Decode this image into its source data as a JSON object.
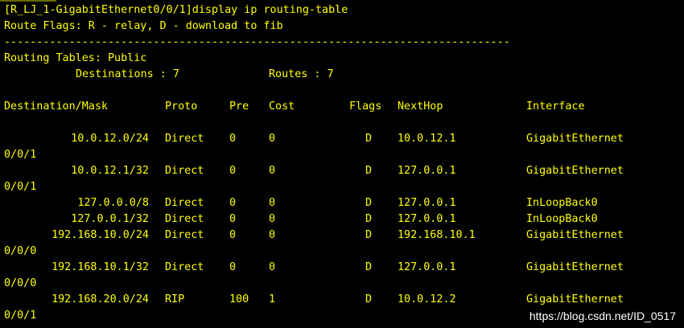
{
  "terminal": {
    "command": "[R_LJ_1-GigabitEthernet0/0/1]display ip routing-table",
    "flags_line": "Route Flags: R - relay, D - download to fib",
    "separator": "------------------------------------------------------------------------------",
    "tables_line": "Routing Tables: Public",
    "destinations_label": "Destinations : 7",
    "routes_label": "Routes : 7",
    "headers": {
      "dest": "Destination/Mask",
      "proto": "Proto",
      "pre": "Pre",
      "cost": "Cost",
      "flags": "Flags",
      "nexthop": "NextHop",
      "interface": "Interface"
    },
    "routes": [
      {
        "dest": "10.0.12.0/24",
        "proto": "Direct",
        "pre": "0",
        "cost": "0",
        "flags": "D",
        "nexthop": "10.0.12.1",
        "interface": "GigabitEthernet",
        "wrap": "0/0/1"
      },
      {
        "dest": "10.0.12.1/32",
        "proto": "Direct",
        "pre": "0",
        "cost": "0",
        "flags": "D",
        "nexthop": "127.0.0.1",
        "interface": "GigabitEthernet",
        "wrap": "0/0/1"
      },
      {
        "dest": "127.0.0.0/8",
        "proto": "Direct",
        "pre": "0",
        "cost": "0",
        "flags": "D",
        "nexthop": "127.0.0.1",
        "interface": "InLoopBack0",
        "wrap": ""
      },
      {
        "dest": "127.0.0.1/32",
        "proto": "Direct",
        "pre": "0",
        "cost": "0",
        "flags": "D",
        "nexthop": "127.0.0.1",
        "interface": "InLoopBack0",
        "wrap": ""
      },
      {
        "dest": "192.168.10.0/24",
        "proto": "Direct",
        "pre": "0",
        "cost": "0",
        "flags": "D",
        "nexthop": "192.168.10.1",
        "interface": "GigabitEthernet",
        "wrap": "0/0/0"
      },
      {
        "dest": "192.168.10.1/32",
        "proto": "Direct",
        "pre": "0",
        "cost": "0",
        "flags": "D",
        "nexthop": "127.0.0.1",
        "interface": "GigabitEthernet",
        "wrap": "0/0/0"
      },
      {
        "dest": "192.168.20.0/24",
        "proto": "RIP",
        "pre": "100",
        "cost": "1",
        "flags": "D",
        "nexthop": "10.0.12.2",
        "interface": "GigabitEthernet",
        "wrap": "0/0/1"
      }
    ]
  },
  "watermark": "https://blog.csdn.net/ID_0517",
  "colors": {
    "background": "#000000",
    "text": "#ffff00",
    "watermark": "#ffffff"
  }
}
